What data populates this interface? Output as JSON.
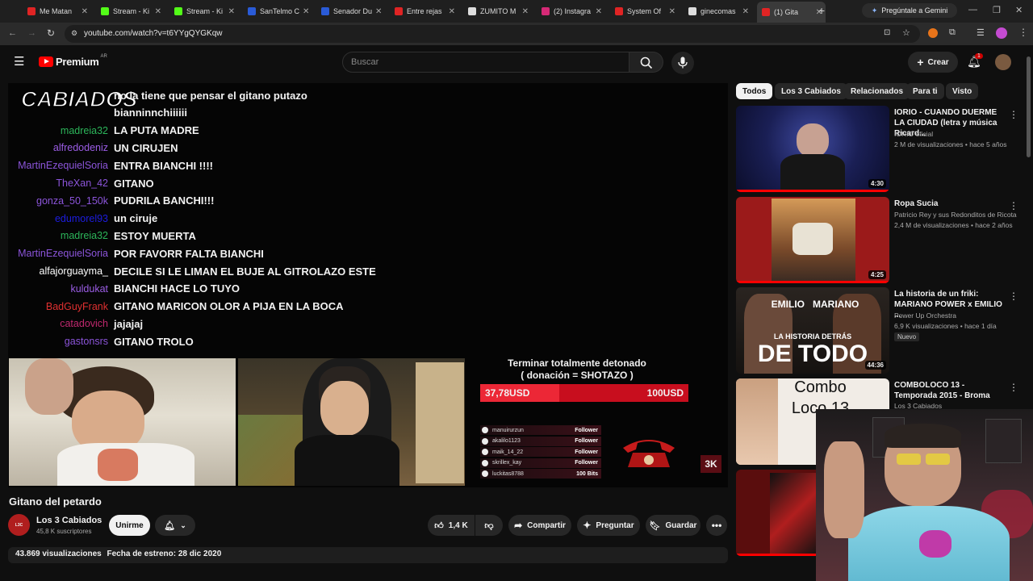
{
  "browser": {
    "tabs": [
      {
        "label": "Me Matan",
        "color": "#e02424"
      },
      {
        "label": "Stream - Ki",
        "color": "#53fc18"
      },
      {
        "label": "Stream - Ki",
        "color": "#53fc18"
      },
      {
        "label": "SanTelmo C",
        "color": "#2a5bd7"
      },
      {
        "label": "Senador Du",
        "color": "#2a5bd7"
      },
      {
        "label": "Entre rejas",
        "color": "#e02424"
      },
      {
        "label": "ZUMITO M",
        "color": "#dddddd"
      },
      {
        "label": "(2) Instagra",
        "color": "#d62976"
      },
      {
        "label": "System Of",
        "color": "#e02424"
      },
      {
        "label": "ginecomas",
        "color": "#dddddd"
      },
      {
        "label": "(1) Gita",
        "color": "#e02424"
      }
    ],
    "gemini_label": "Pregúntale a Gemini",
    "url": "youtube.com/watch?v=t6YYgQYGKqw"
  },
  "youtube": {
    "logo_text": "Premium",
    "region": "AR",
    "search_placeholder": "Buscar",
    "create_label": "Crear",
    "notification_count": "1"
  },
  "video": {
    "chat": [
      {
        "user": "",
        "msg": "no la tiene que pensar el gitano putazo",
        "color": "#ffffff"
      },
      {
        "user": "",
        "msg": "bianninnchiiiiii",
        "color": "#7d5bd0"
      },
      {
        "user": "madreia32",
        "msg": "LA PUTA MADRE",
        "color": "#2cb55a"
      },
      {
        "user": "alfredodeniz",
        "msg": "UN CIRUJEN",
        "color": "#9b5de5"
      },
      {
        "user": "MartinEzequielSoria",
        "msg": "ENTRA BIANCHI !!!!",
        "color": "#8b54d9"
      },
      {
        "user": "TheXan_42",
        "msg": "GITANO",
        "color": "#8b54d9"
      },
      {
        "user": "gonza_50_150k",
        "msg": "PUDRILA BANCHI!!!",
        "color": "#8b54d9"
      },
      {
        "user": "edumorel93",
        "msg": "un ciruje",
        "color": "#1d1de0"
      },
      {
        "user": "madreia32",
        "msg": "ESTOY MUERTA",
        "color": "#2cb55a"
      },
      {
        "user": "MartinEzequielSoria",
        "msg": "POR FAVORR FALTA BIANCHI",
        "color": "#8b54d9"
      },
      {
        "user": "alfajorguayma_",
        "msg": "DECILE SI LE LIMAN EL BUJE AL GITROLAZO ESTE",
        "color": "#ffffff"
      },
      {
        "user": "kuldukat",
        "msg": "BIANCHI HACE LO TUYO",
        "color": "#9b5de5"
      },
      {
        "user": "BadGuyFrank",
        "msg": "GITANO MARICON OLOR A PIJA EN LA BOCA",
        "color": "#e03030"
      },
      {
        "user": "catadovich",
        "msg": "jajajaj",
        "color": "#c0286e"
      },
      {
        "user": "gastonsrs",
        "msg": "GITANO TROLO",
        "color": "#8b54d9"
      }
    ],
    "overlay_logo": "CABIADOS",
    "goal_title": "Terminar totalmente detonado",
    "goal_subtitle": "( donación = SHOTAZO )",
    "goal_current": "37,78USD",
    "goal_target": "100USD",
    "goal_progress_fraction": 0.378,
    "follow_events": [
      {
        "name": "manuirurzun",
        "type": "Follower"
      },
      {
        "name": "akalilo1123",
        "type": "Follower"
      },
      {
        "name": "maik_14_22",
        "type": "Follower"
      },
      {
        "name": "skrillex_kay",
        "type": "Follower"
      },
      {
        "name": "luckitas8788",
        "type": "100 Bits"
      }
    ],
    "badge": "3K"
  },
  "info": {
    "title": "Gitano del petardo",
    "channel": "Los 3 Cabiados",
    "subscribers": "45,8 K suscriptores",
    "join_label": "Unirme",
    "likes": "1,4 K",
    "share_label": "Compartir",
    "ask_label": "Preguntar",
    "save_label": "Guardar",
    "views": "43.869 visualizaciones",
    "premiere": "Fecha de estreno: 28 dic 2020"
  },
  "sidebar": {
    "chips": [
      "Todos",
      "Los 3 Cabiados",
      "Relacionados",
      "Para ti",
      "Visto"
    ],
    "recs": [
      {
        "title": "IORIO -  CUANDO DUERME LA CIUDAD (letra y música Ricard...",
        "channel": "IORIO oficial",
        "meta": "2 M de visualizaciones • hace 5 años",
        "duration": "4:30"
      },
      {
        "title": "Ropa Sucia",
        "channel": "Patricio Rey y sus Redonditos de Ricota",
        "meta": "2,4 M de visualizaciones • hace 2 años",
        "duration": "4:25"
      },
      {
        "title": "La historia de un friki: MARIANO POWER x EMILIO ...",
        "channel": "Power Up Orchestra",
        "meta": "6,9 K visualizaciones • hace 1 día",
        "duration": "44:36",
        "badge": "Nuevo",
        "thumb_top": "EMILIO   MARIANO",
        "thumb_sub": "LA HISTORIA DETRÁS",
        "thumb_big": "DE TODO"
      },
      {
        "title": "COMBOLOCO 13 - Temporada 2015 - Broma",
        "channel": "Los 3 Cabiados",
        "thumb_text": "Combo Loco 13"
      }
    ]
  }
}
